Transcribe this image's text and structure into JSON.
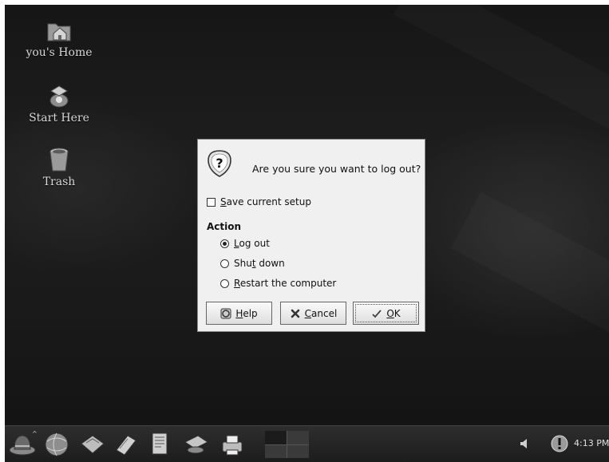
{
  "desktop": {
    "icons": [
      {
        "label": "you's Home",
        "icon": "home-folder-icon"
      },
      {
        "label": "Start Here",
        "icon": "start-here-icon"
      },
      {
        "label": "Trash",
        "icon": "trash-icon"
      }
    ]
  },
  "dialog": {
    "question": "Are you sure you want to log out?",
    "save_setup": {
      "label_accel": "S",
      "label_rest": "ave current setup",
      "checked": false
    },
    "action_heading": "Action",
    "options": [
      {
        "pre": "",
        "accel": "L",
        "post": "og out",
        "selected": true
      },
      {
        "pre": "Shu",
        "accel": "t",
        "post": " down",
        "selected": false
      },
      {
        "pre": "",
        "accel": "R",
        "post": "estart the computer",
        "selected": false
      }
    ],
    "buttons": {
      "help": {
        "accel": "H",
        "rest": "elp",
        "icon": "help-icon"
      },
      "cancel": {
        "accel": "C",
        "rest": "ancel",
        "icon": "cancel-icon"
      },
      "ok": {
        "accel": "O",
        "rest": "K",
        "icon": "ok-check-icon"
      }
    }
  },
  "panel": {
    "launchers": [
      "main-menu-icon",
      "web-browser-icon",
      "email-icon",
      "text-editor-icon",
      "office-writer-icon",
      "office-presentation-icon",
      "printer-icon"
    ],
    "workspaces": 4,
    "active_workspace": 1,
    "tray": [
      "volume-icon",
      "update-alert-icon"
    ],
    "clock": "4:13 PM"
  },
  "colors": {
    "desktop_bg": "#1a1a1a",
    "dialog_bg": "#f0f0f0",
    "panel_bg": "#262626"
  }
}
